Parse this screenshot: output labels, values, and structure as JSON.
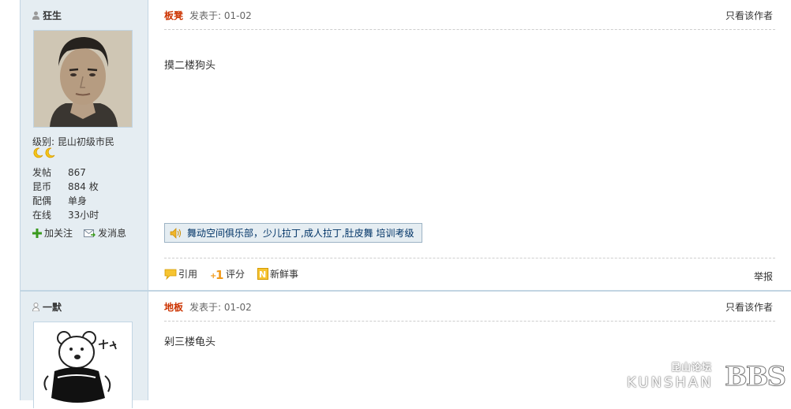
{
  "posts": [
    {
      "author": "狂生",
      "level_label": "级别: 昆山初级市民",
      "stats": [
        {
          "label": "发帖",
          "value": "867"
        },
        {
          "label": "昆币",
          "value": "884 枚"
        },
        {
          "label": "配偶",
          "value": "单身"
        },
        {
          "label": "在线",
          "value": "33小时"
        }
      ],
      "actions": {
        "follow": "加关注",
        "message": "发消息"
      },
      "floor": "板凳",
      "posted_at": "发表于: 01-02",
      "only_author": "只看该作者",
      "content": "摸二楼狗头",
      "ad_text": "舞动空间俱乐部，少儿拉丁,成人拉丁,肚皮舞 培训考级",
      "buttons": {
        "quote": "引用",
        "rate": "评分",
        "fresh": "新鲜事"
      },
      "report": "举报"
    },
    {
      "author": "一默",
      "floor": "地板",
      "posted_at": "发表于: 01-02",
      "only_author": "只看该作者",
      "content": "剁三楼龟头"
    }
  ],
  "watermark": {
    "top": "昆山论坛",
    "main": "KUNSHAN",
    "bbs": "BBS"
  },
  "colors": {
    "sidebar_bg": "#e5edf2",
    "border": "#c2d5e3",
    "floor": "#cc3300",
    "link": "#003366"
  },
  "icons": [
    "user-icon",
    "moon-icon",
    "plus-icon",
    "mail-icon",
    "speaker-icon",
    "quote-icon",
    "rate-icon",
    "fresh-icon"
  ]
}
